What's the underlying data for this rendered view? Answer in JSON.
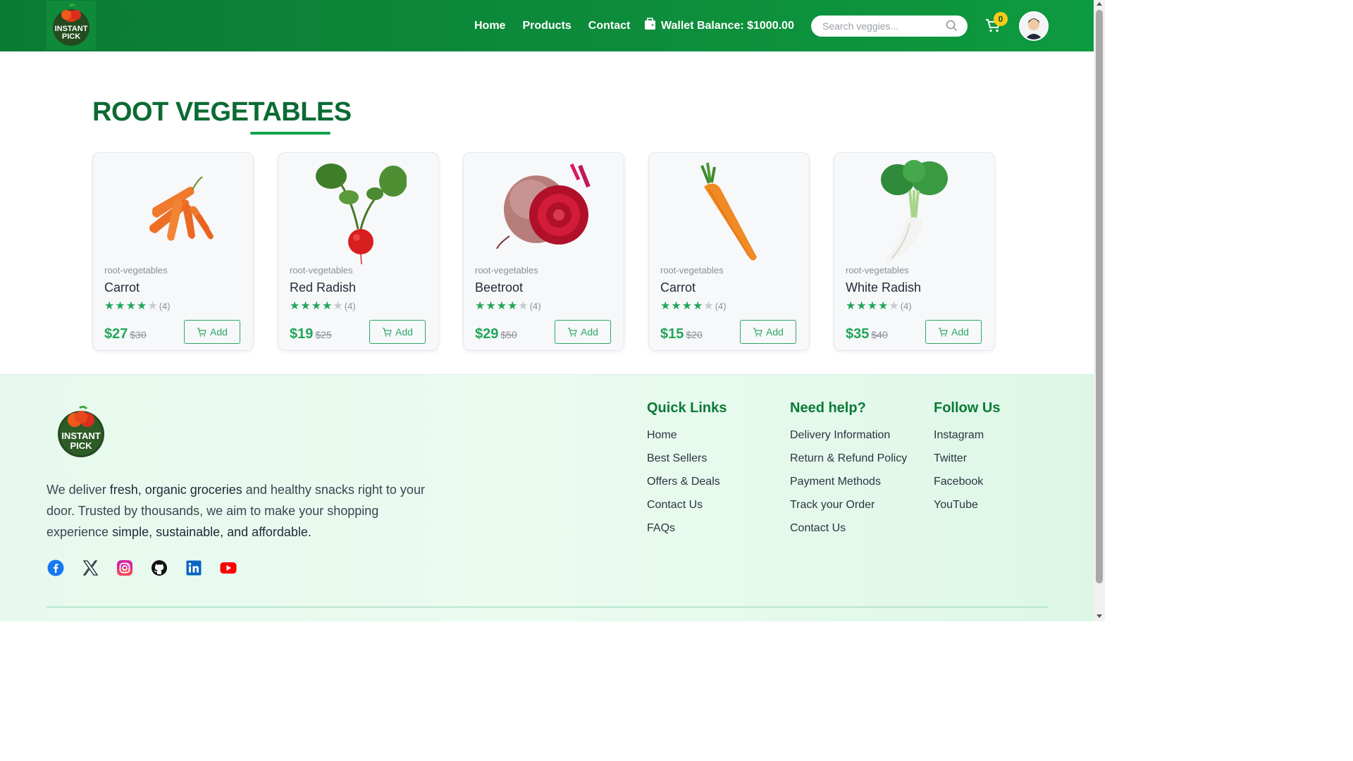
{
  "brand": {
    "logo_text_line1": "INSTANT",
    "logo_text_line2": "PICK"
  },
  "nav": {
    "links": [
      "Home",
      "Products",
      "Contact"
    ],
    "wallet_label": "Wallet Balance: $1000.00",
    "search_placeholder": "Search veggies...",
    "cart_count": "0"
  },
  "section": {
    "title": "ROOT VEGETABLES"
  },
  "products": [
    {
      "category": "root-vegetables",
      "name": "Carrot",
      "rating": 4,
      "rating_label": "(4)",
      "price": "$27",
      "old_price": "$30",
      "add_label": "Add",
      "image": "carrots-bunch"
    },
    {
      "category": "root-vegetables",
      "name": "Red Radish",
      "rating": 4,
      "rating_label": "(4)",
      "price": "$19",
      "old_price": "$25",
      "add_label": "Add",
      "image": "red-radish"
    },
    {
      "category": "root-vegetables",
      "name": "Beetroot",
      "rating": 4,
      "rating_label": "(4)",
      "price": "$29",
      "old_price": "$50",
      "add_label": "Add",
      "image": "beetroot"
    },
    {
      "category": "root-vegetables",
      "name": "Carrot",
      "rating": 4,
      "rating_label": "(4)",
      "price": "$15",
      "old_price": "$20",
      "add_label": "Add",
      "image": "single-carrot"
    },
    {
      "category": "root-vegetables",
      "name": "White Radish",
      "rating": 4,
      "rating_label": "(4)",
      "price": "$35",
      "old_price": "$40",
      "add_label": "Add",
      "image": "white-radish"
    }
  ],
  "footer": {
    "desc_1": "We deliver ",
    "desc_bold_1": "fresh, organic groceries",
    "desc_2": " and healthy snacks right to your door. Trusted by thousands, we aim to make your shopping experience ",
    "desc_bold_2": "simple, sustainable, and affordable.",
    "socials": [
      "facebook-icon",
      "x-icon",
      "instagram-icon",
      "github-icon",
      "linkedin-icon",
      "youtube-icon"
    ],
    "columns": [
      {
        "title": "Quick Links",
        "links": [
          "Home",
          "Best Sellers",
          "Offers & Deals",
          "Contact Us",
          "FAQs"
        ]
      },
      {
        "title": "Need help?",
        "links": [
          "Delivery Information",
          "Return & Refund Policy",
          "Payment Methods",
          "Track your Order",
          "Contact Us"
        ]
      },
      {
        "title": "Follow Us",
        "links": [
          "Instagram",
          "Twitter",
          "Facebook",
          "YouTube"
        ]
      }
    ]
  },
  "colors": {
    "primary": "#0e9a40",
    "accent": "#22a55a",
    "badge": "#facc15"
  }
}
